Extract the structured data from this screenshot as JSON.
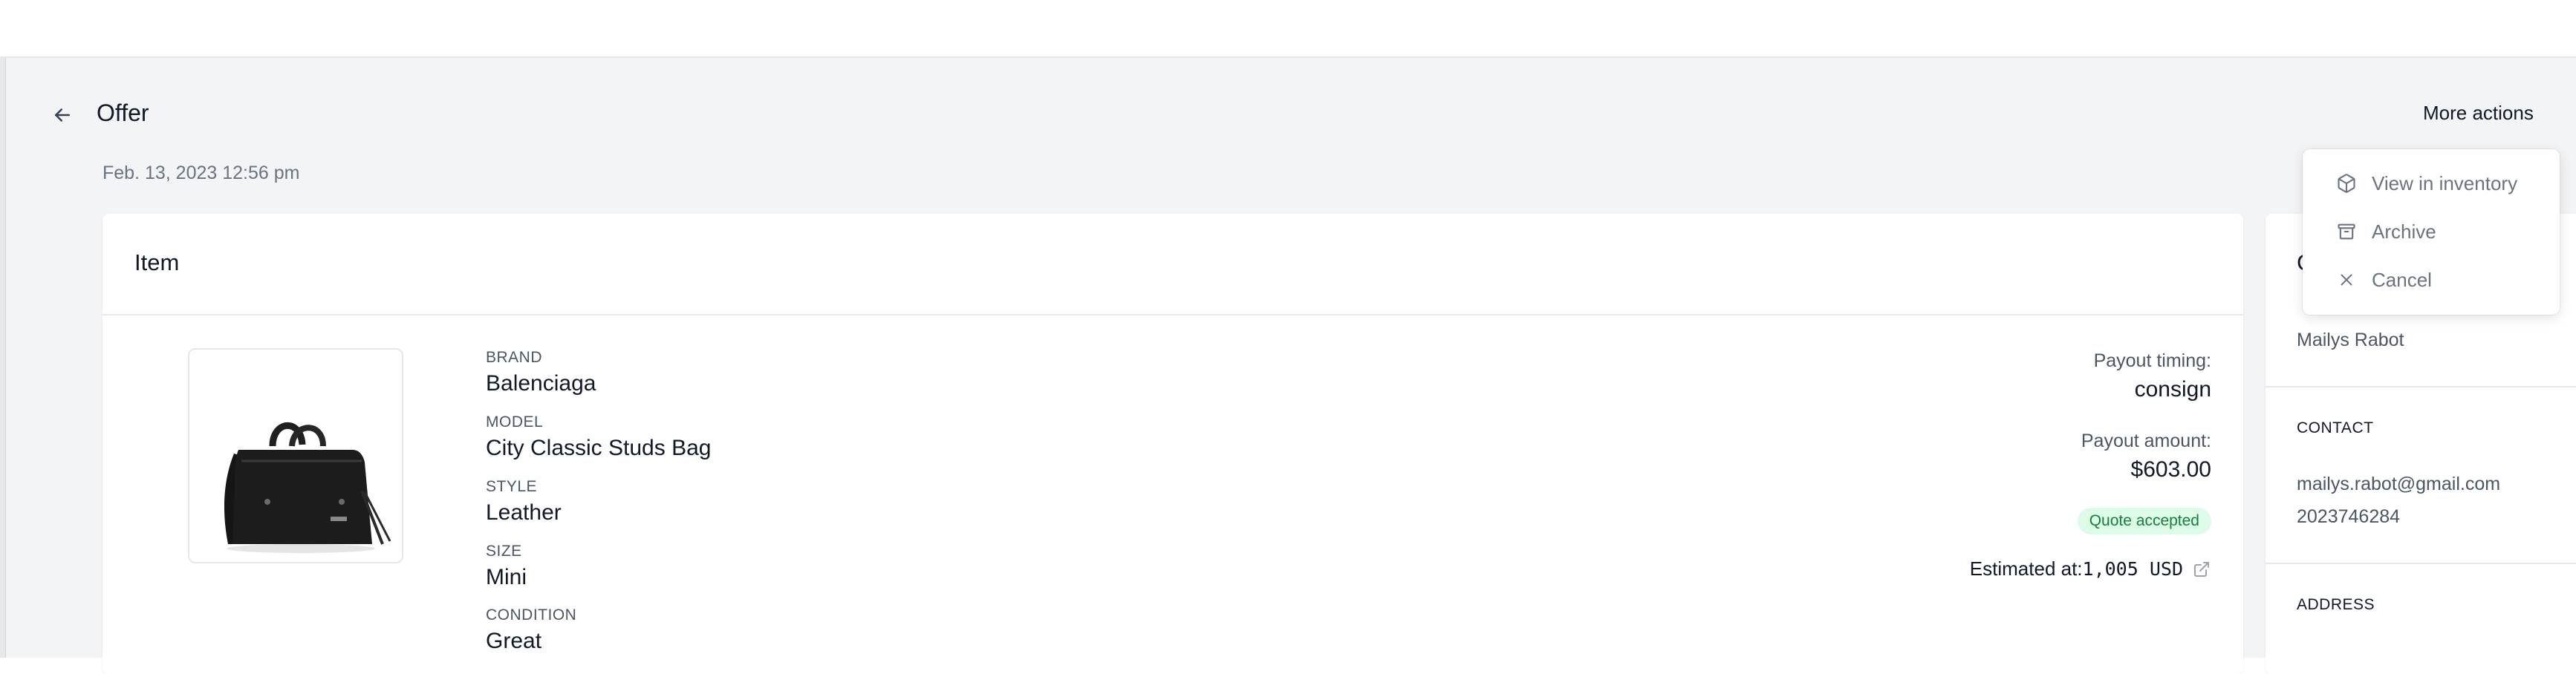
{
  "header": {
    "title": "Offer",
    "date": "Feb. 13, 2023 12:56 pm",
    "more_actions_label": "More actions"
  },
  "actions_menu": {
    "items": [
      {
        "label": "View in inventory",
        "icon": "cube-icon"
      },
      {
        "label": "Archive",
        "icon": "archive-icon"
      },
      {
        "label": "Cancel",
        "icon": "x-icon"
      }
    ]
  },
  "item_card": {
    "title": "Item",
    "image_alt": "black handbag",
    "attributes": [
      {
        "label": "BRAND",
        "value": "Balenciaga"
      },
      {
        "label": "MODEL",
        "value": "City Classic Studs Bag"
      },
      {
        "label": "STYLE",
        "value": "Leather"
      },
      {
        "label": "SIZE",
        "value": "Mini"
      },
      {
        "label": "CONDITION",
        "value": "Great"
      }
    ],
    "payout_timing_label": "Payout timing:",
    "payout_timing_value": "consign",
    "payout_amount_label": "Payout amount:",
    "payout_amount_value": "$603.00",
    "status_badge": "Quote accepted",
    "estimated_label": "Estimated at:",
    "estimated_value": "1,005 USD",
    "status_colors": {
      "badge_bg": "#dcfce7",
      "badge_text": "#15803d"
    }
  },
  "customer_card": {
    "title_visible": "C",
    "name": "Mailys Rabot",
    "contact_title": "CONTACT",
    "email": "mailys.rabot@gmail.com",
    "phone": "2023746284",
    "address_title": "ADDRESS"
  }
}
